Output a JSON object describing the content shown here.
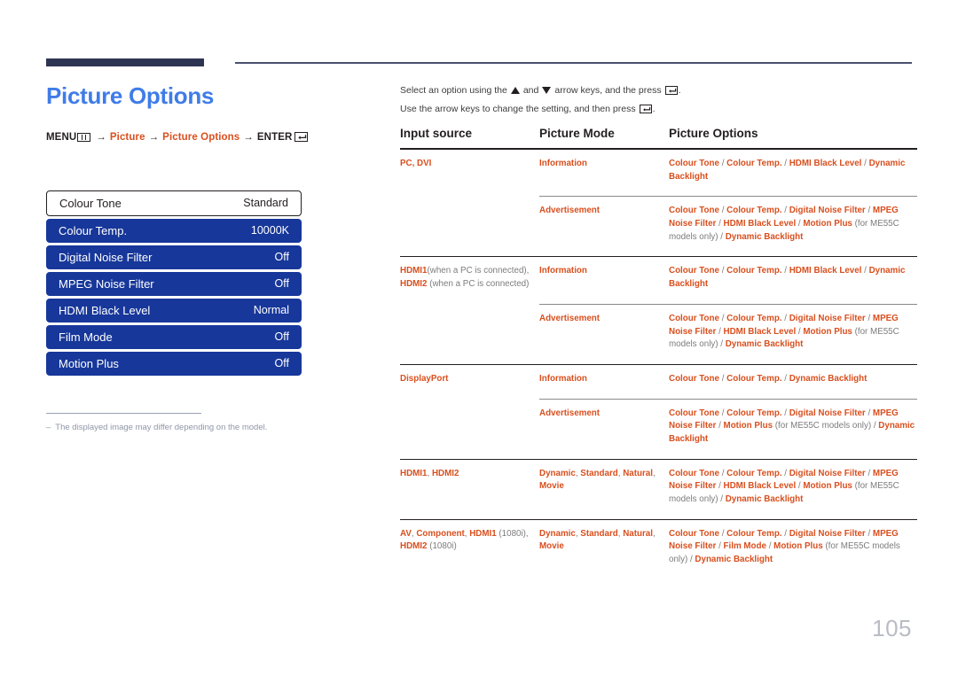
{
  "page": {
    "title": "Picture Options",
    "number": "105",
    "title_color": "#3f7ce8",
    "accent_color": "#d94f1e",
    "osd_color": "#17379a"
  },
  "breadcrumb": {
    "menu_label": "MENU",
    "menu_icon": "menu-bars-icon",
    "arrow": "→",
    "step1": "Picture",
    "step2": "Picture Options",
    "enter_label": "ENTER",
    "enter_icon": "enter-key-icon"
  },
  "osd": {
    "items": [
      {
        "label": "Colour Tone",
        "value": "Standard",
        "selected": false
      },
      {
        "label": "Colour Temp.",
        "value": "10000K",
        "selected": true
      },
      {
        "label": "Digital Noise Filter",
        "value": "Off",
        "selected": true
      },
      {
        "label": "MPEG Noise Filter",
        "value": "Off",
        "selected": true
      },
      {
        "label": "HDMI Black Level",
        "value": "Normal",
        "selected": true
      },
      {
        "label": "Film Mode",
        "value": "Off",
        "selected": true
      },
      {
        "label": "Motion Plus",
        "value": "Off",
        "selected": true
      }
    ]
  },
  "footnote": {
    "dash": "–",
    "text": "The displayed image may differ depending on the model."
  },
  "intro": {
    "line1_a": "Select an option using the",
    "line1_b": "and",
    "line1_c": "arrow keys, and the press",
    "line1_d": ".",
    "line2_a": "Use the arrow keys to change the setting, and then press",
    "line2_b": ".",
    "up_icon": "arrow-up-icon",
    "down_icon": "arrow-down-icon",
    "enter_icon": "enter-key-icon"
  },
  "table": {
    "headers": {
      "col1": "Input source",
      "col2": "Picture Mode",
      "col3": "Picture Options"
    },
    "groups": [
      {
        "source": [
          {
            "t": "PC, DVI",
            "style": "accent"
          }
        ],
        "rows": [
          {
            "mode": [
              {
                "t": "Information",
                "style": "accent"
              }
            ],
            "options": [
              {
                "t": "Colour Tone",
                "style": "accent"
              },
              {
                "t": " / ",
                "style": "sep"
              },
              {
                "t": "Colour Temp.",
                "style": "accent"
              },
              {
                "t": " / ",
                "style": "sep"
              },
              {
                "t": "HDMI Black Level",
                "style": "accent"
              },
              {
                "t": " / ",
                "style": "sep"
              },
              {
                "t": "Dynamic Backlight",
                "style": "accent"
              }
            ]
          },
          {
            "mode": [
              {
                "t": "Advertisement",
                "style": "accent"
              }
            ],
            "options": [
              {
                "t": "Colour Tone",
                "style": "accent"
              },
              {
                "t": " / ",
                "style": "sep"
              },
              {
                "t": "Colour Temp.",
                "style": "accent"
              },
              {
                "t": " / ",
                "style": "sep"
              },
              {
                "t": "Digital Noise Filter",
                "style": "accent"
              },
              {
                "t": " / ",
                "style": "sep"
              },
              {
                "t": "MPEG Noise Filter",
                "style": "accent"
              },
              {
                "t": " / ",
                "style": "sep"
              },
              {
                "t": "HDMI Black Level",
                "style": "accent"
              },
              {
                "t": " / ",
                "style": "sep"
              },
              {
                "t": "Motion Plus",
                "style": "accent"
              },
              {
                "t": " (for ME55C models only) ",
                "style": "gray"
              },
              {
                "t": "/ ",
                "style": "sep"
              },
              {
                "t": "Dynamic Backlight",
                "style": "accent"
              }
            ]
          }
        ]
      },
      {
        "source": [
          {
            "t": "HDMI1",
            "style": "accent"
          },
          {
            "t": "(when a PC is connected), ",
            "style": "gray"
          },
          {
            "t": "HDMI2",
            "style": "accent"
          },
          {
            "t": " (when a PC is connected)",
            "style": "gray"
          }
        ],
        "rows": [
          {
            "mode": [
              {
                "t": "Information",
                "style": "accent"
              }
            ],
            "options": [
              {
                "t": "Colour Tone",
                "style": "accent"
              },
              {
                "t": " / ",
                "style": "sep"
              },
              {
                "t": "Colour Temp.",
                "style": "accent"
              },
              {
                "t": " / ",
                "style": "sep"
              },
              {
                "t": "HDMI Black Level",
                "style": "accent"
              },
              {
                "t": " / ",
                "style": "sep"
              },
              {
                "t": "Dynamic Backlight",
                "style": "accent"
              }
            ]
          },
          {
            "mode": [
              {
                "t": "Advertisement",
                "style": "accent"
              }
            ],
            "options": [
              {
                "t": "Colour Tone",
                "style": "accent"
              },
              {
                "t": " / ",
                "style": "sep"
              },
              {
                "t": "Colour Temp.",
                "style": "accent"
              },
              {
                "t": " / ",
                "style": "sep"
              },
              {
                "t": "Digital Noise Filter",
                "style": "accent"
              },
              {
                "t": " / ",
                "style": "sep"
              },
              {
                "t": "MPEG Noise Filter",
                "style": "accent"
              },
              {
                "t": " / ",
                "style": "sep"
              },
              {
                "t": "HDMI Black Level",
                "style": "accent"
              },
              {
                "t": " / ",
                "style": "sep"
              },
              {
                "t": "Motion Plus",
                "style": "accent"
              },
              {
                "t": " (for ME55C models only) ",
                "style": "gray"
              },
              {
                "t": "/ ",
                "style": "sep"
              },
              {
                "t": "Dynamic Backlight",
                "style": "accent"
              }
            ]
          }
        ]
      },
      {
        "source": [
          {
            "t": "DisplayPort",
            "style": "accent"
          }
        ],
        "rows": [
          {
            "mode": [
              {
                "t": "Information",
                "style": "accent"
              }
            ],
            "options": [
              {
                "t": "Colour Tone",
                "style": "accent"
              },
              {
                "t": " / ",
                "style": "sep"
              },
              {
                "t": "Colour Temp.",
                "style": "accent"
              },
              {
                "t": " / ",
                "style": "sep"
              },
              {
                "t": "Dynamic Backlight",
                "style": "accent"
              }
            ]
          },
          {
            "mode": [
              {
                "t": "Advertisement",
                "style": "accent"
              }
            ],
            "options": [
              {
                "t": "Colour Tone",
                "style": "accent"
              },
              {
                "t": " / ",
                "style": "sep"
              },
              {
                "t": "Colour Temp.",
                "style": "accent"
              },
              {
                "t": " / ",
                "style": "sep"
              },
              {
                "t": "Digital Noise Filter",
                "style": "accent"
              },
              {
                "t": " / ",
                "style": "sep"
              },
              {
                "t": "MPEG Noise Filter",
                "style": "accent"
              },
              {
                "t": " / ",
                "style": "sep"
              },
              {
                "t": "Motion Plus",
                "style": "accent"
              },
              {
                "t": " (for ME55C models only) ",
                "style": "gray"
              },
              {
                "t": "/ ",
                "style": "sep"
              },
              {
                "t": "Dynamic Backlight",
                "style": "accent"
              }
            ]
          }
        ]
      },
      {
        "source": [
          {
            "t": "HDMI1",
            "style": "accent"
          },
          {
            "t": ", ",
            "style": "gray"
          },
          {
            "t": "HDMI2",
            "style": "accent"
          }
        ],
        "rows": [
          {
            "mode": [
              {
                "t": "Dynamic",
                "style": "accent"
              },
              {
                "t": ", ",
                "style": "gray"
              },
              {
                "t": "Standard",
                "style": "accent"
              },
              {
                "t": ", ",
                "style": "gray"
              },
              {
                "t": "Natural",
                "style": "accent"
              },
              {
                "t": ", ",
                "style": "gray"
              },
              {
                "t": "Movie",
                "style": "accent"
              }
            ],
            "options": [
              {
                "t": "Colour Tone",
                "style": "accent"
              },
              {
                "t": " / ",
                "style": "sep"
              },
              {
                "t": "Colour Temp.",
                "style": "accent"
              },
              {
                "t": " / ",
                "style": "sep"
              },
              {
                "t": "Digital Noise Filter",
                "style": "accent"
              },
              {
                "t": " / ",
                "style": "sep"
              },
              {
                "t": "MPEG Noise Filter",
                "style": "accent"
              },
              {
                "t": " / ",
                "style": "sep"
              },
              {
                "t": "HDMI Black Level",
                "style": "accent"
              },
              {
                "t": " / ",
                "style": "sep"
              },
              {
                "t": "Motion Plus",
                "style": "accent"
              },
              {
                "t": " (for ME55C models only) ",
                "style": "gray"
              },
              {
                "t": "/ ",
                "style": "sep"
              },
              {
                "t": "Dynamic Backlight",
                "style": "accent"
              }
            ]
          }
        ]
      },
      {
        "source": [
          {
            "t": "AV",
            "style": "accent"
          },
          {
            "t": ", ",
            "style": "gray"
          },
          {
            "t": "Component",
            "style": "accent"
          },
          {
            "t": ", ",
            "style": "gray"
          },
          {
            "t": "HDMI1",
            "style": "accent"
          },
          {
            "t": " (1080i), ",
            "style": "gray"
          },
          {
            "t": "HDMI2",
            "style": "accent"
          },
          {
            "t": " (1080i)",
            "style": "gray"
          }
        ],
        "rows": [
          {
            "mode": [
              {
                "t": "Dynamic",
                "style": "accent"
              },
              {
                "t": ", ",
                "style": "gray"
              },
              {
                "t": "Standard",
                "style": "accent"
              },
              {
                "t": ", ",
                "style": "gray"
              },
              {
                "t": "Natural",
                "style": "accent"
              },
              {
                "t": ", ",
                "style": "gray"
              },
              {
                "t": "Movie",
                "style": "accent"
              }
            ],
            "options": [
              {
                "t": "Colour Tone",
                "style": "accent"
              },
              {
                "t": " / ",
                "style": "sep"
              },
              {
                "t": "Colour Temp.",
                "style": "accent"
              },
              {
                "t": " / ",
                "style": "sep"
              },
              {
                "t": "Digital Noise Filter",
                "style": "accent"
              },
              {
                "t": " / ",
                "style": "sep"
              },
              {
                "t": "MPEG Noise Filter",
                "style": "accent"
              },
              {
                "t": " / ",
                "style": "sep"
              },
              {
                "t": "Film Mode",
                "style": "accent"
              },
              {
                "t": " / ",
                "style": "sep"
              },
              {
                "t": "Motion Plus",
                "style": "accent"
              },
              {
                "t": " (for ME55C models only) ",
                "style": "gray"
              },
              {
                "t": "/ ",
                "style": "sep"
              },
              {
                "t": "Dynamic Backlight",
                "style": "accent"
              }
            ]
          }
        ]
      }
    ]
  }
}
